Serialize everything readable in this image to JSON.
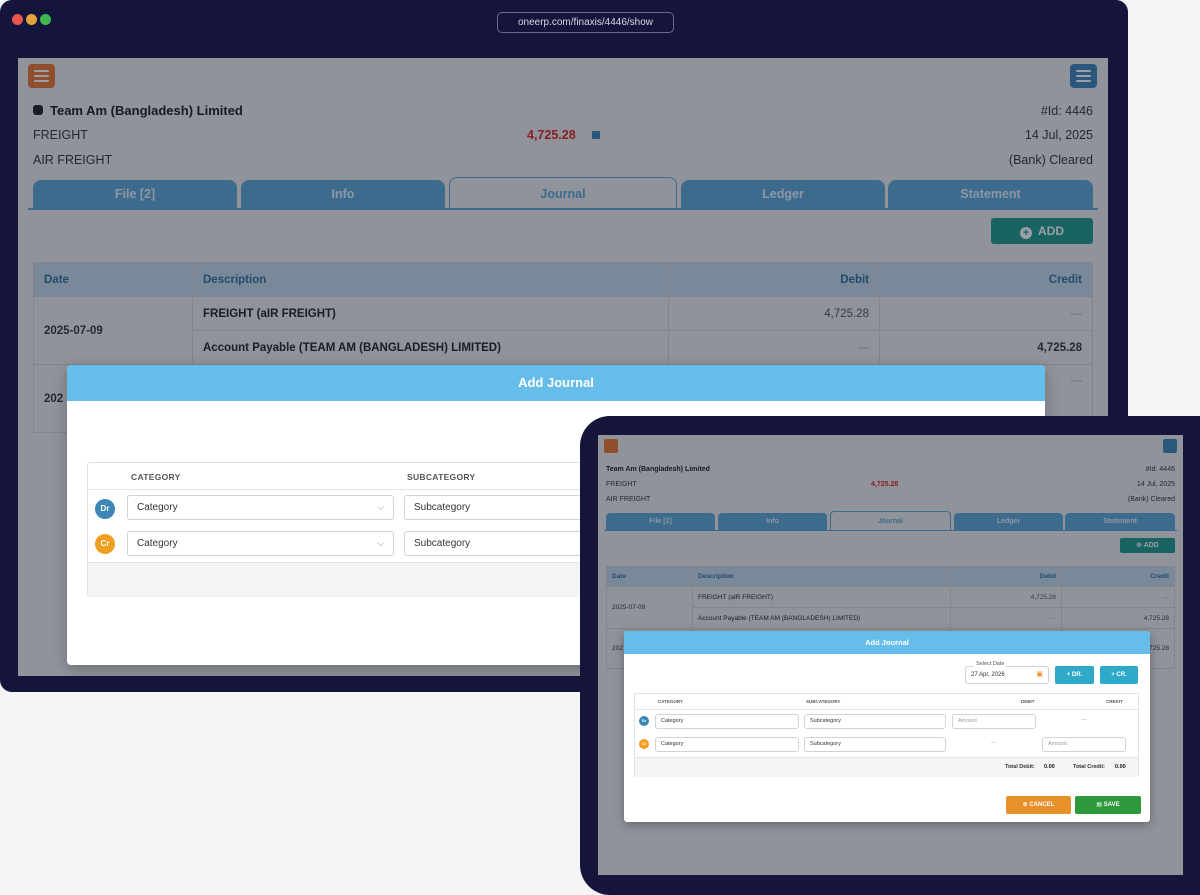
{
  "browser": {
    "url": "oneerp.com/finaxis/4446/show"
  },
  "record": {
    "title": "Team Am (Bangladesh) Limited",
    "line1": "FREIGHT",
    "line2": "AIR FREIGHT",
    "amount": "4,725.28",
    "id_label": "#Id: 4446",
    "date": "14 Jul, 2025",
    "status": "(Bank) Cleared"
  },
  "tabs": [
    "File [2]",
    "Info",
    "Journal",
    "Ledger",
    "Statement"
  ],
  "add_label": "ADD",
  "table": {
    "headers": {
      "date": "Date",
      "description": "Description",
      "debit": "Debit",
      "credit": "Credit"
    },
    "rows": [
      {
        "date": "2025-07-09",
        "description": "FREIGHT (aIR FREIGHT)",
        "debit": "4,725.28",
        "credit": "—"
      },
      {
        "date": "",
        "description": "Account Payable (TEAM AM (BANGLADESH) LIMITED)",
        "debit": "—",
        "credit": "4,725.28"
      }
    ],
    "partial_date": "202",
    "partial_credit": "725.28",
    "partial_dash": "—"
  },
  "modal": {
    "title": "Add Journal",
    "select_date_label": "Select Date",
    "select_date_value": "27 Apr, 2026",
    "dr_button": "+ DR.",
    "cr_button": "+ CR.",
    "col_category": "CATEGORY",
    "col_subcategory": "SUBCATEGORY",
    "col_debit": "DEBIT",
    "col_credit": "CREDIT",
    "dr_badge": "Dr",
    "cr_badge": "Cr",
    "category_placeholder": "Category",
    "subcategory_placeholder": "Subcategory",
    "amount_placeholder": "Amount",
    "dash": "—",
    "total_debit_label": "Total Debit:",
    "total_debit_value": "0.00",
    "total_credit_label": "Total Credit:",
    "total_credit_value": "0.00",
    "cancel_label": "CANCEL",
    "save_label": "SAVE"
  },
  "colors": {
    "frame": "#15143a",
    "tab": "#5aa7d8",
    "header_bar": "#66bde9",
    "amount_red": "#e02424",
    "add_teal": "#1e9c8e",
    "cancel_orange": "#e8902a",
    "save_green": "#2e9a3c",
    "dr_blue": "#3d86b8",
    "cr_orange": "#f0a020"
  }
}
